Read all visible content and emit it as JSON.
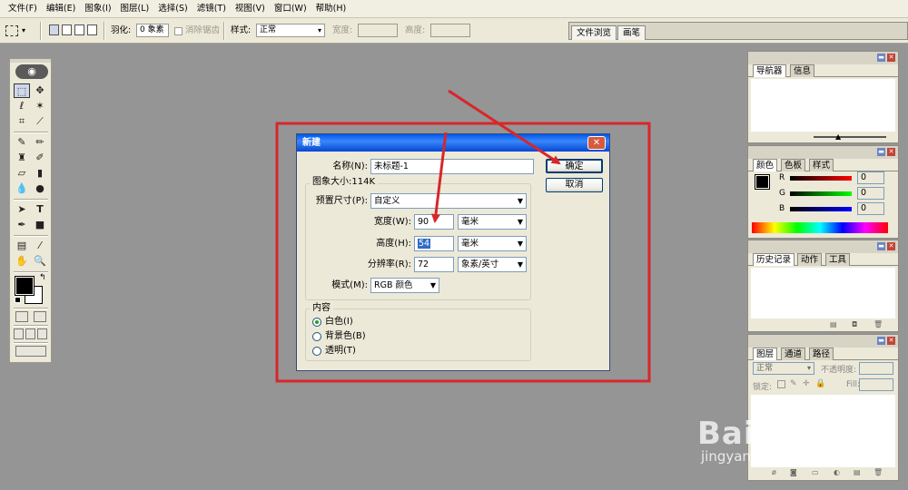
{
  "menu": [
    "文件(F)",
    "编辑(E)",
    "图象(I)",
    "图层(L)",
    "选择(S)",
    "滤镜(T)",
    "视图(V)",
    "窗口(W)",
    "帮助(H)"
  ],
  "options_bar": {
    "feather_label": "羽化:",
    "feather_value": "0 象素",
    "antialias_label": "消除锯齿",
    "style_label": "样式:",
    "style_value": "正常",
    "width_label": "宽度:",
    "height_label": "高度:",
    "tab_file_browser": "文件浏览",
    "tab_brushes": "画笔"
  },
  "dialog": {
    "title": "新建",
    "name_label": "名称(N):",
    "name_value": "未标题-1",
    "image_size_label": "图象大小:114K",
    "preset_label": "预置尺寸(P):",
    "preset_value": "自定义",
    "width_label": "宽度(W):",
    "width_value": "90",
    "width_unit": "毫米",
    "height_label": "高度(H):",
    "height_value": "54",
    "height_unit": "毫米",
    "resolution_label": "分辨率(R):",
    "resolution_value": "72",
    "resolution_unit": "象素/英寸",
    "mode_label": "模式(M):",
    "mode_value": "RGB 颜色",
    "content_label": "内容",
    "content_white": "白色(I)",
    "content_background": "背景色(B)",
    "content_transparent": "透明(T)",
    "content_selected": "white",
    "ok_label": "确定",
    "cancel_label": "取消"
  },
  "panels": {
    "navigator": {
      "tabs": [
        "导航器",
        "信息"
      ]
    },
    "color": {
      "tabs": [
        "颜色",
        "色板",
        "样式"
      ],
      "channels": [
        {
          "label": "R",
          "value": "0"
        },
        {
          "label": "G",
          "value": "0"
        },
        {
          "label": "B",
          "value": "0"
        }
      ]
    },
    "history": {
      "tabs": [
        "历史记录",
        "动作",
        "工具"
      ]
    },
    "layers": {
      "tabs": [
        "图层",
        "通道",
        "路径"
      ],
      "blend_mode": "正常",
      "opacity_label": "不透明度:",
      "lock_label": "锁定:",
      "fill_label": "Fill:"
    }
  },
  "watermark": {
    "brand": "Bai du 经验",
    "url": "jingyan.baidu.com"
  },
  "colors": {
    "annotation_red": "#d8262a",
    "title_blue": "#0a5ae8",
    "workspace_gray": "#959595"
  }
}
